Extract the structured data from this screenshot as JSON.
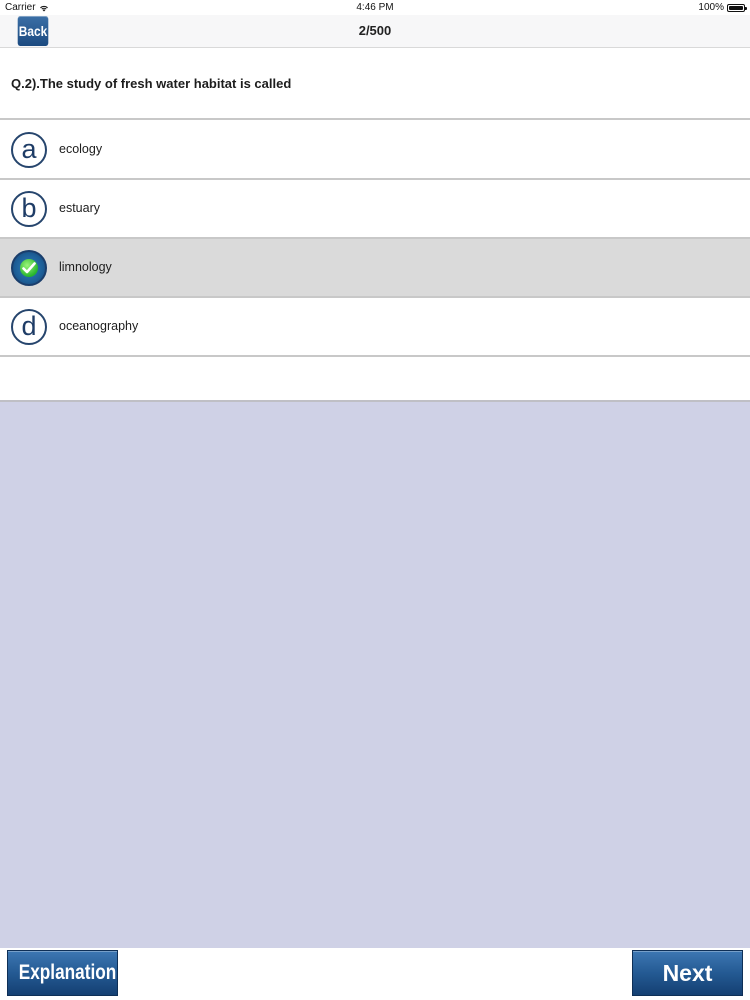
{
  "status_bar": {
    "carrier": "Carrier",
    "time": "4:46 PM",
    "battery": "100%"
  },
  "nav": {
    "back_label": "Back",
    "title": "2/500"
  },
  "question": {
    "text": "Q.2).The study of fresh water habitat is called"
  },
  "options": [
    {
      "letter": "a",
      "label": "ecology",
      "selected": false
    },
    {
      "letter": "b",
      "label": "estuary",
      "selected": false
    },
    {
      "letter": "c",
      "label": "limnology",
      "selected": true,
      "icon": "checkmark-icon"
    },
    {
      "letter": "d",
      "label": "oceanography",
      "selected": false
    }
  ],
  "bottom": {
    "explanation_label": "Explanation",
    "next_label": "Next"
  },
  "colors": {
    "accent": "#245a93",
    "content_background": "#cfd1e6",
    "selected_row": "#dadada"
  }
}
